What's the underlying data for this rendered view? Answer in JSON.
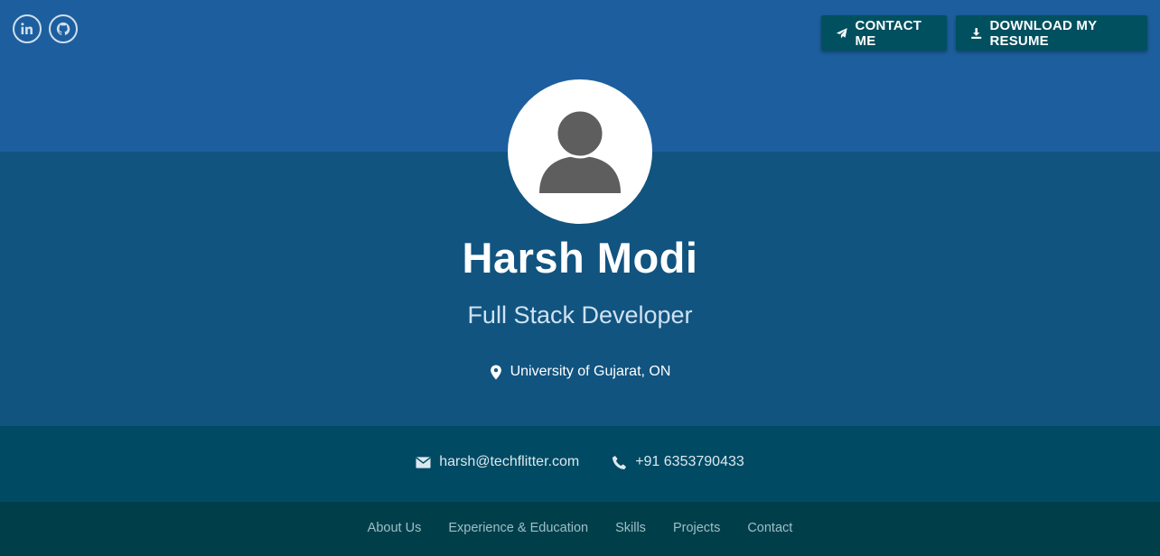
{
  "social": {
    "linkedin_icon": "linkedin-icon",
    "github_icon": "github-icon"
  },
  "actions": {
    "contact_label": "CONTACT ME",
    "resume_label": "DOWNLOAD MY RESUME"
  },
  "profile": {
    "name": "Harsh Modi",
    "role": "Full Stack Developer",
    "location": "University of Gujarat, ON"
  },
  "contact": {
    "email": "harsh@techflitter.com",
    "phone": "+91 6353790433"
  },
  "nav": {
    "items": [
      "About Us",
      "Experience & Education",
      "Skills",
      "Projects",
      "Contact"
    ]
  },
  "colors": {
    "top_band": "#1d5f9e",
    "mid_band": "#115480",
    "contact_band": "#004a63",
    "nav_band": "#003f4a",
    "button": "#00505f"
  }
}
